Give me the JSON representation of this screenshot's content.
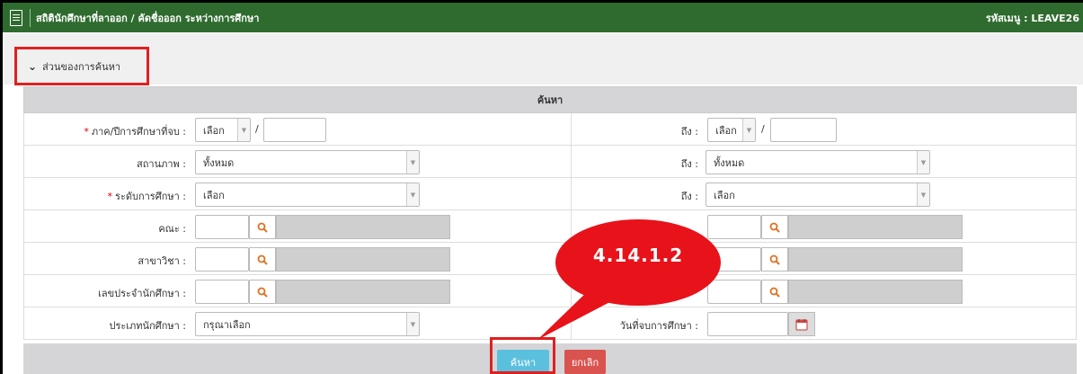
{
  "window": {
    "title": "สถิตินักศึกษาที่ลาออก / คัดชื่อออก ระหว่างการศึกษา",
    "menu_code": "รหัสเมนู : LEAVE26"
  },
  "search_section": {
    "toggle_label": "ส่วนของการค้นหา",
    "panel_title": "ค้นหา"
  },
  "form": {
    "semester_label": "ภาค/ปีการศึกษาที่จบ :",
    "semester_select": "เลือก",
    "to_label": "ถึง :",
    "semester_to_select": "เลือก",
    "status_label": "สถานภาพ :",
    "status_value": "ทั้งหมด",
    "status_to_value": "ทั้งหมด",
    "level_label": "ระดับการศึกษา :",
    "level_value": "เลือก",
    "level_to_value": "เลือก",
    "faculty_label": "คณะ :",
    "major_label": "สาขาวิชา :",
    "student_id_label": "เลขประจำนักศึกษา :",
    "student_type_label": "ประเภทนักศึกษา :",
    "student_type_value": "กรุณาเลือก",
    "graduation_date_label": "วันที่จบการศึกษา :",
    "slash": "/"
  },
  "buttons": {
    "search": "ค้นหา",
    "cancel": "ยกเลิก"
  },
  "annotation": {
    "callout_text": "4.14.1.2",
    "highlight_color": "#e02020"
  },
  "colors": {
    "title_bar": "#2f6b2f",
    "search_button": "#5bc0de",
    "cancel_button": "#d9534f",
    "required_mark": "#dd0000"
  }
}
